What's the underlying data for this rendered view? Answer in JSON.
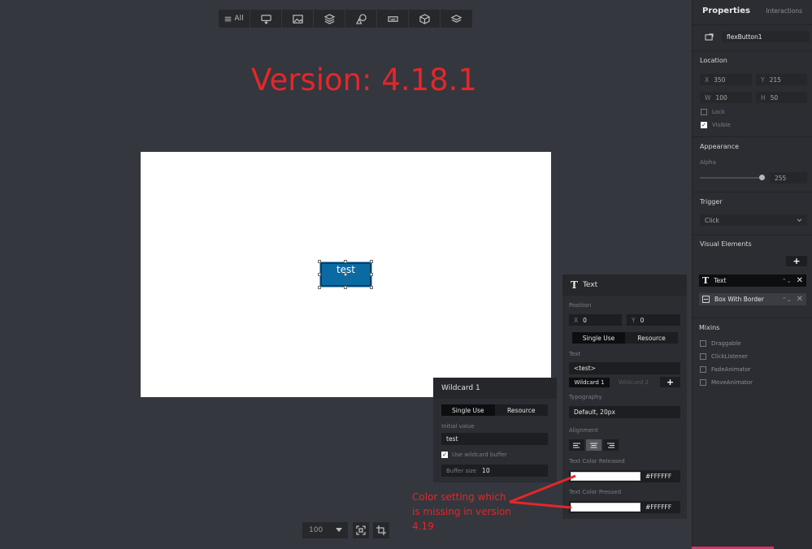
{
  "toolbar": {
    "all_label": "All",
    "icons": [
      "interaction-icon",
      "image-icon",
      "layers-icon",
      "shapes-icon",
      "keyboard-icon",
      "cube-icon",
      "stack-icon"
    ]
  },
  "annotation_title": "Version: 4.18.1",
  "canvas": {
    "button_text": "test"
  },
  "zoom": {
    "value": "100"
  },
  "wildcard_panel": {
    "title": "Wildcard 1",
    "tabs": [
      "Single Use",
      "Resource"
    ],
    "initial_value_label": "Initial value",
    "initial_value": "test",
    "use_buffer_label": "Use wildcard buffer",
    "use_buffer_checked": true,
    "buffer_size_label": "Buffer size",
    "buffer_size": "10"
  },
  "text_panel": {
    "title": "Text",
    "position_label": "Position",
    "x_key": "X",
    "x_value": "0",
    "y_key": "Y",
    "y_value": "0",
    "tabs": [
      "Single Use",
      "Resource"
    ],
    "text_label": "Text",
    "text_value": "<test>",
    "wildcard_tabs": [
      "Wildcard 1",
      "Wildcard 2"
    ],
    "typography_label": "Typography",
    "typography_value": "Default, 20px",
    "alignment_label": "Alignment",
    "color_released_label": "Text Color Released",
    "color_released_value": "#FFFFFF",
    "color_pressed_label": "Text Color Pressed",
    "color_pressed_value": "#FFFFFF"
  },
  "annotation": "Color setting which is missing in version 4.19",
  "properties": {
    "tab_properties": "Properties",
    "tab_interactions": "Interactions",
    "name": "flexButton1",
    "location_title": "Location",
    "x": "350",
    "y": "215",
    "w": "100",
    "h": "50",
    "lock_label": "Lock",
    "visible_label": "Visible",
    "appearance_title": "Appearance",
    "alpha_label": "Alpha",
    "alpha_value": "255",
    "trigger_title": "Trigger",
    "trigger_value": "Click",
    "visual_elements_title": "Visual Elements",
    "visual_elements": [
      "Text",
      "Box With Border"
    ],
    "mixins_title": "Mixins",
    "mixins": [
      "Draggable",
      "ClickListener",
      "FadeAnimator",
      "MoveAnimator"
    ]
  },
  "colors": {
    "background": "#34373d",
    "panel": "#2b2d32",
    "accent_red": "#e5262b",
    "button_blue": "#0c6aa3"
  }
}
